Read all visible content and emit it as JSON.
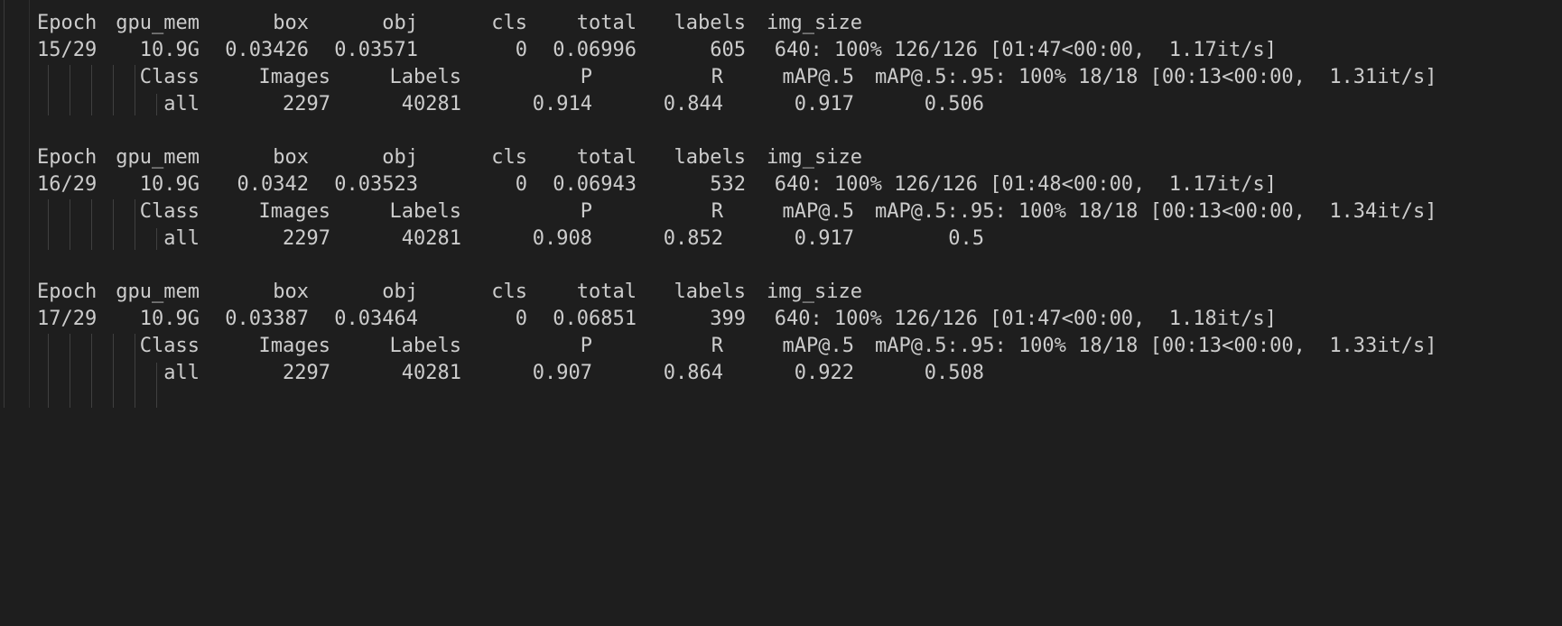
{
  "colors": {
    "background": "#1e1e1e",
    "text": "#cccccc",
    "guide": "#404040"
  },
  "header": {
    "epoch": "Epoch",
    "gpu_mem": "gpu_mem",
    "box": "box",
    "obj": "obj",
    "cls": "cls",
    "total": "total",
    "labels": "labels",
    "img_size": "img_size"
  },
  "val_header": {
    "class": "Class",
    "images": "Images",
    "labels": "Labels",
    "p": "P",
    "r": "R",
    "map50": "mAP@.5",
    "map50_95_progress": "mAP@.5:.95: 100% 18/18 [00:13<00:00,  1.31it/s]"
  },
  "epochs": [
    {
      "epoch": "15/29",
      "gpu_mem": "10.9G",
      "box": "0.03426",
      "obj": "0.03571",
      "cls": "0",
      "total": "0.06996",
      "labels": "605",
      "img_size_progress": "640: 100% 126/126 [01:47<00:00,  1.17it/s]",
      "val_progress": "mAP@.5:.95: 100% 18/18 [00:13<00:00,  1.31it/s]",
      "val": {
        "class": "all",
        "images": "2297",
        "labels": "40281",
        "p": "0.914",
        "r": "0.844",
        "map50": "0.917",
        "map50_95": "0.506"
      }
    },
    {
      "epoch": "16/29",
      "gpu_mem": "10.9G",
      "box": "0.0342",
      "obj": "0.03523",
      "cls": "0",
      "total": "0.06943",
      "labels": "532",
      "img_size_progress": "640: 100% 126/126 [01:48<00:00,  1.17it/s]",
      "val_progress": "mAP@.5:.95: 100% 18/18 [00:13<00:00,  1.34it/s]",
      "val": {
        "class": "all",
        "images": "2297",
        "labels": "40281",
        "p": "0.908",
        "r": "0.852",
        "map50": "0.917",
        "map50_95": "0.5"
      }
    },
    {
      "epoch": "17/29",
      "gpu_mem": "10.9G",
      "box": "0.03387",
      "obj": "0.03464",
      "cls": "0",
      "total": "0.06851",
      "labels": "399",
      "img_size_progress": "640: 100% 126/126 [01:47<00:00,  1.18it/s]",
      "val_progress": "mAP@.5:.95: 100% 18/18 [00:13<00:00,  1.33it/s]",
      "val": {
        "class": "all",
        "images": "2297",
        "labels": "40281",
        "p": "0.907",
        "r": "0.864",
        "map50": "0.922",
        "map50_95": "0.508"
      }
    }
  ]
}
